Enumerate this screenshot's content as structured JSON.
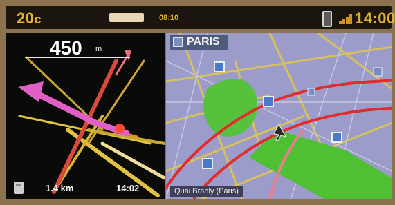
{
  "topbar": {
    "temperature": "20",
    "temperature_unit": "c",
    "time_small": "08:10",
    "clock": "14:00",
    "colors": {
      "accent": "#e3b42c",
      "bar_bg": "#1a150f",
      "frame": "#8d7250"
    }
  },
  "guidance": {
    "distance_value": "450",
    "distance_unit": "m",
    "remaining_distance": "1.4 km",
    "arrival_time": "14:02",
    "icons": [
      "route-arrow-icon",
      "settings-icon"
    ]
  },
  "map": {
    "city": "PARIS",
    "street": "Quai Branly (Paris)",
    "map_colors": {
      "bg": "#9c9ccb",
      "route": "#e82a2a",
      "park": "#4fbf33"
    }
  }
}
